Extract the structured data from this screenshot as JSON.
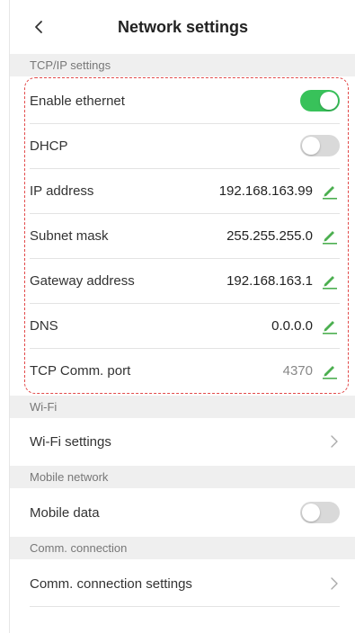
{
  "header": {
    "title": "Network settings",
    "back_icon": "chevron-left-icon"
  },
  "sections": {
    "tcpip": {
      "title": "TCP/IP settings",
      "enable_ethernet": {
        "label": "Enable ethernet",
        "on": true
      },
      "dhcp": {
        "label": "DHCP",
        "on": false
      },
      "ip_address": {
        "label": "IP address",
        "value": "192.168.163.99"
      },
      "subnet_mask": {
        "label": "Subnet mask",
        "value": "255.255.255.0"
      },
      "gateway": {
        "label": "Gateway address",
        "value": "192.168.163.1"
      },
      "dns": {
        "label": "DNS",
        "value": "0.0.0.0"
      },
      "tcp_port": {
        "label": "TCP Comm. port",
        "value": "4370"
      }
    },
    "wifi": {
      "title": "Wi-Fi",
      "settings_label": "Wi-Fi settings"
    },
    "mobile": {
      "title": "Mobile network",
      "data_label": "Mobile data",
      "data_on": false
    },
    "comm": {
      "title": "Comm. connection",
      "settings_label": "Comm. connection settings"
    }
  },
  "colors": {
    "accent": "#38c25a",
    "edit_icon": "#4caf50",
    "highlight": "#e24a4a"
  },
  "icons": {
    "edit": "pencil-icon",
    "chevron": "chevron-right-icon"
  }
}
